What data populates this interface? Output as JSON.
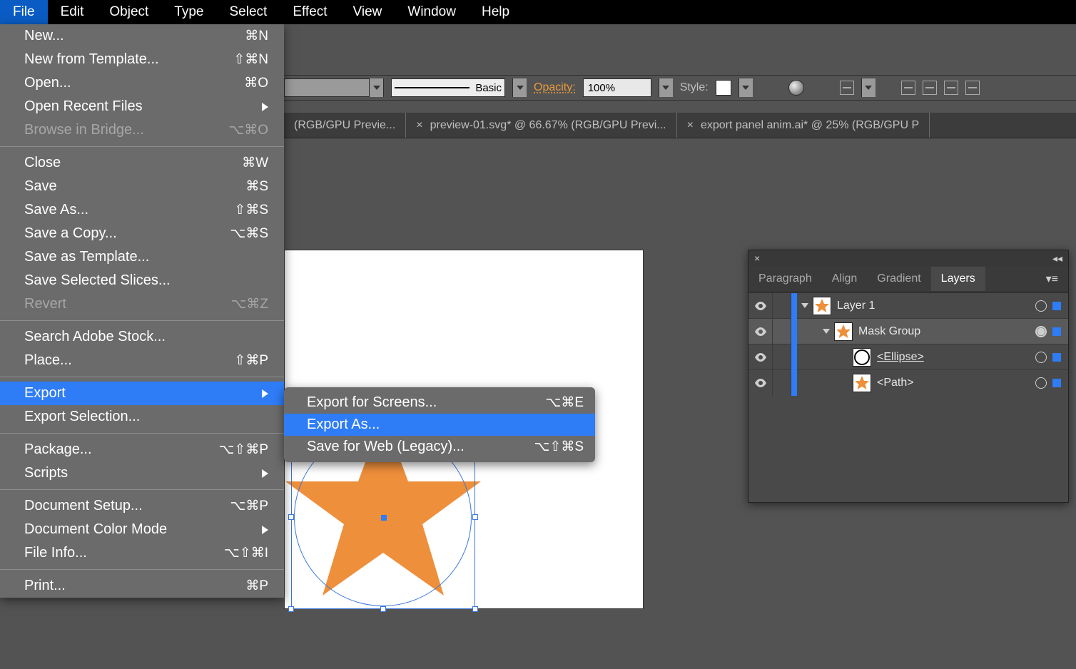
{
  "menubar": {
    "items": [
      "File",
      "Edit",
      "Object",
      "Type",
      "Select",
      "Effect",
      "View",
      "Window",
      "Help"
    ],
    "active": "File"
  },
  "file_menu": {
    "groups": [
      {
        "items": [
          {
            "label": "New...",
            "shortcut": "⌘N"
          },
          {
            "label": "New from Template...",
            "shortcut": "⇧⌘N"
          },
          {
            "label": "Open...",
            "shortcut": "⌘O"
          },
          {
            "label": "Open Recent Files",
            "submenu": true
          },
          {
            "label": "Browse in Bridge...",
            "shortcut": "⌥⌘O",
            "disabled": true
          }
        ]
      },
      {
        "items": [
          {
            "label": "Close",
            "shortcut": "⌘W"
          },
          {
            "label": "Save",
            "shortcut": "⌘S"
          },
          {
            "label": "Save As...",
            "shortcut": "⇧⌘S"
          },
          {
            "label": "Save a Copy...",
            "shortcut": "⌥⌘S"
          },
          {
            "label": "Save as Template..."
          },
          {
            "label": "Save Selected Slices..."
          },
          {
            "label": "Revert",
            "shortcut": "⌥⌘Z",
            "disabled": true
          }
        ]
      },
      {
        "items": [
          {
            "label": "Search Adobe Stock..."
          },
          {
            "label": "Place...",
            "shortcut": "⇧⌘P"
          }
        ]
      },
      {
        "items": [
          {
            "label": "Export",
            "submenu": true,
            "highlight": true
          },
          {
            "label": "Export Selection..."
          }
        ]
      },
      {
        "items": [
          {
            "label": "Package...",
            "shortcut": "⌥⇧⌘P"
          },
          {
            "label": "Scripts",
            "submenu": true
          }
        ]
      },
      {
        "items": [
          {
            "label": "Document Setup...",
            "shortcut": "⌥⌘P"
          },
          {
            "label": "Document Color Mode",
            "submenu": true
          },
          {
            "label": "File Info...",
            "shortcut": "⌥⇧⌘I"
          }
        ]
      },
      {
        "items": [
          {
            "label": "Print...",
            "shortcut": "⌘P"
          }
        ]
      }
    ]
  },
  "export_submenu": {
    "items": [
      {
        "label": "Export for Screens...",
        "shortcut": "⌥⌘E"
      },
      {
        "label": "Export As...",
        "highlight": true
      },
      {
        "label": "Save for Web (Legacy)...",
        "shortcut": "⌥⇧⌘S"
      }
    ]
  },
  "controlbar": {
    "stroke_label": "Basic",
    "opacity_label": "Opacity:",
    "opacity_value": "100%",
    "style_label": "Style:"
  },
  "doc_tabs": [
    {
      "title": "(RGB/GPU Previe..."
    },
    {
      "title": "preview-01.svg* @ 66.67% (RGB/GPU Previ...",
      "closable": true
    },
    {
      "title": "export panel anim.ai* @ 25% (RGB/GPU P",
      "closable": true
    }
  ],
  "panel": {
    "tabs": [
      "Paragraph",
      "Align",
      "Gradient",
      "Layers"
    ],
    "active": "Layers",
    "layers": [
      {
        "name": "Layer 1",
        "thumb": "star",
        "expanded": true,
        "indent": 0,
        "target": false,
        "sel": true
      },
      {
        "name": "Mask Group",
        "thumb": "star",
        "expanded": true,
        "indent": 1,
        "selected": true,
        "target": true,
        "sel": true
      },
      {
        "name": "<Ellipse>",
        "thumb": "ellipse",
        "indent": 2,
        "underline": true,
        "target": false,
        "sel": true
      },
      {
        "name": "<Path>",
        "thumb": "star",
        "indent": 2,
        "target": false,
        "sel": true
      }
    ]
  }
}
